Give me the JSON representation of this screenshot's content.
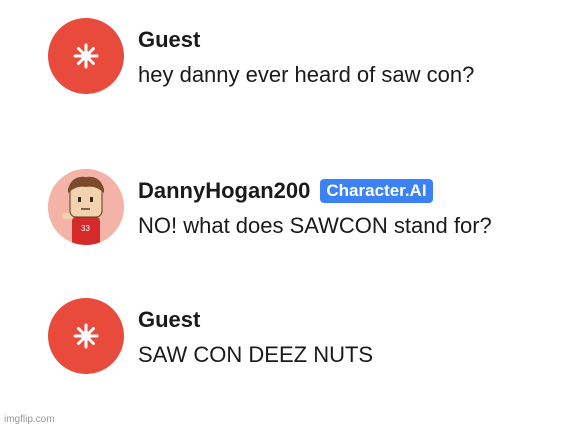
{
  "messages": [
    {
      "sender": "Guest",
      "avatar_icon": "sparkle-icon",
      "avatar_color": "#e84a3c",
      "text": "hey danny ever heard of saw con?"
    },
    {
      "sender": "DannyHogan200",
      "badge": "Character.AI",
      "avatar_icon": "character-avatar",
      "avatar_color": "#f4b3a7",
      "text": "NO! what does SAWCON stand for?"
    },
    {
      "sender": "Guest",
      "avatar_icon": "sparkle-icon",
      "avatar_color": "#e84a3c",
      "text": "SAW CON DEEZ NUTS"
    }
  ],
  "badge_color": "#3b82f6",
  "watermark": "imgflip.com"
}
